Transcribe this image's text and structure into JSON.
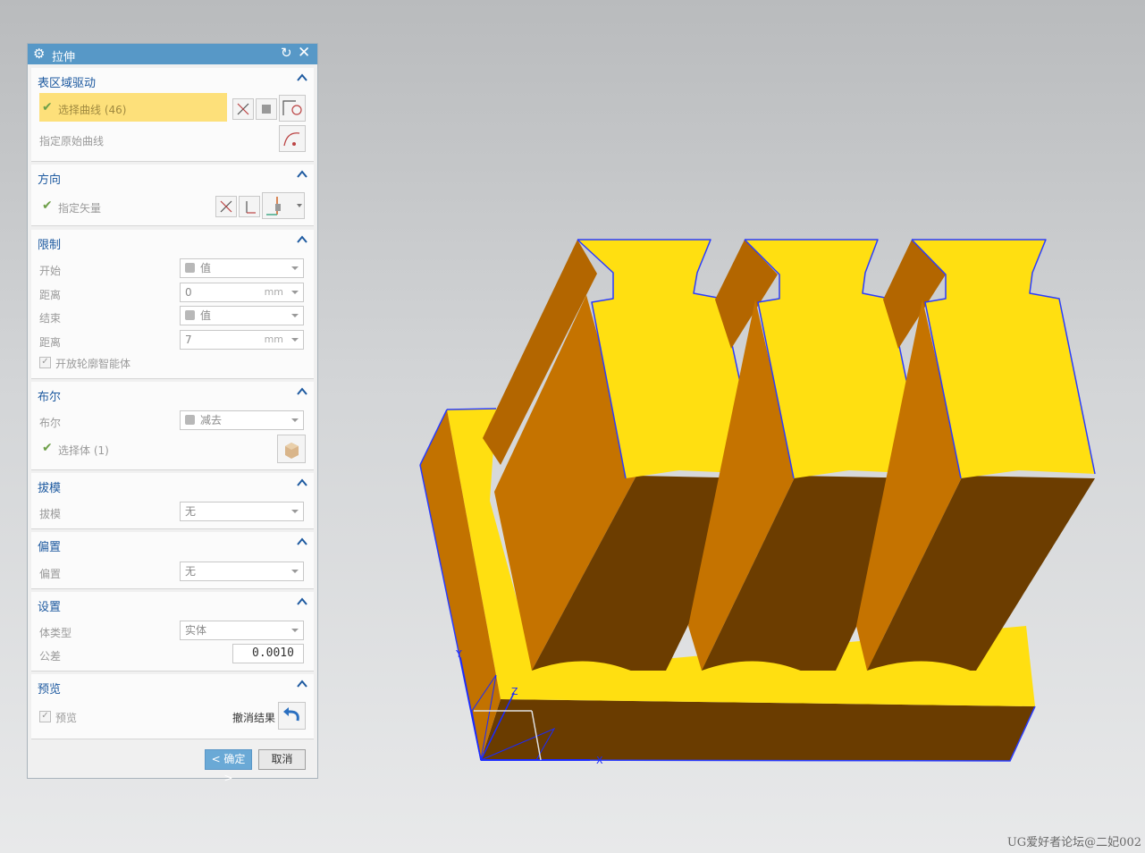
{
  "dialog": {
    "title": "拉伸",
    "sections": {
      "surface": {
        "header": "表区域驱动",
        "select_curve": "选择曲线 (46)",
        "original_curve": "指定原始曲线"
      },
      "direction": {
        "header": "方向",
        "vector": "指定矢量"
      },
      "limits": {
        "header": "限制",
        "start_label": "开始",
        "start_value": "值",
        "dist1_label": "距离",
        "dist1_value": "0",
        "dist1_unit": "mm",
        "end_label": "结束",
        "end_value": "值",
        "dist2_label": "距离",
        "dist2_value": "7",
        "dist2_unit": "mm",
        "open_profile": "开放轮廓智能体"
      },
      "boolean": {
        "header": "布尔",
        "bool_label": "布尔",
        "bool_value": "减去",
        "select_body": "选择体 (1)"
      },
      "draft": {
        "header": "拔模",
        "draft_label": "拔模",
        "draft_value": "无"
      },
      "offset": {
        "header": "偏置",
        "offset_label": "偏置",
        "offset_value": "无"
      },
      "settings": {
        "header": "设置",
        "body_type_label": "体类型",
        "body_type_value": "实体",
        "tolerance_label": "公差",
        "tolerance_value": "0.0010"
      },
      "preview": {
        "header": "预览",
        "preview_label": "预览",
        "undo_result": "撤消结果"
      }
    },
    "ok_label": "< 确定 >",
    "cancel_label": "取消"
  },
  "viewport": {
    "axis_x": "X",
    "axis_y": "Y",
    "axis_z": "Z",
    "colors": {
      "face_top": "#ffdf11",
      "face_side": "#c77700",
      "face_dark": "#6c3d00",
      "edge": "#2a3cff"
    }
  },
  "watermark": "UG爱好者论坛@二妃002"
}
